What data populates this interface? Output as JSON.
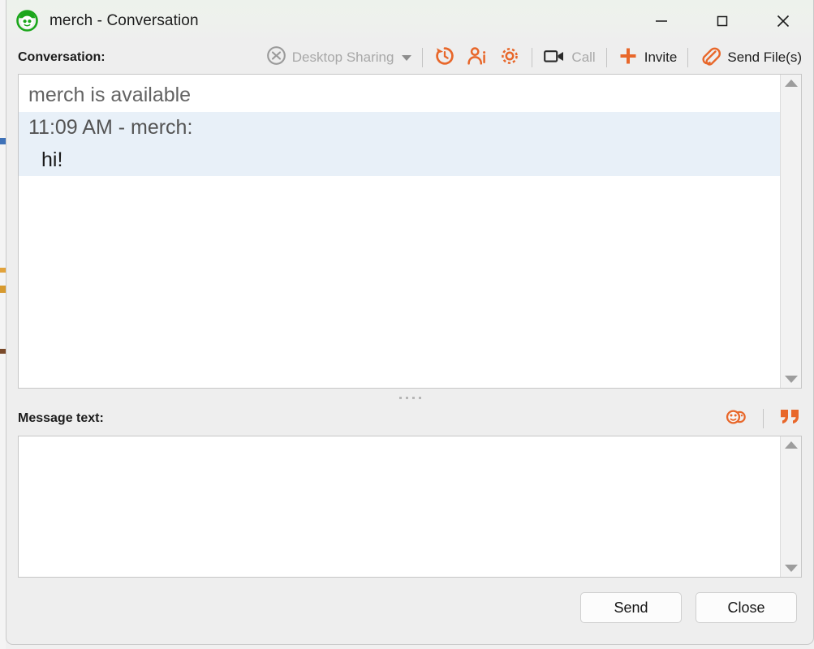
{
  "window": {
    "title": "merch - Conversation",
    "app_icon": "pidgin-buddy-icon",
    "controls": {
      "minimize": "minimize-icon",
      "maximize": "maximize-icon",
      "close": "close-icon"
    }
  },
  "conversation_section": {
    "label": "Conversation:"
  },
  "toolbar": {
    "items": [
      {
        "id": "desktop-sharing",
        "label": "Desktop Sharing",
        "icon": "desktop-sharing-icon",
        "disabled": true,
        "has_caret": true
      },
      {
        "id": "history",
        "label": "",
        "icon": "history-icon",
        "disabled": false
      },
      {
        "id": "user-info",
        "label": "",
        "icon": "user-info-icon",
        "disabled": false
      },
      {
        "id": "settings",
        "label": "",
        "icon": "gear-icon",
        "disabled": false
      },
      {
        "id": "call",
        "label": "Call",
        "icon": "video-call-icon",
        "disabled": true
      },
      {
        "id": "invite",
        "label": "Invite",
        "icon": "plus-icon",
        "disabled": false
      },
      {
        "id": "send-files",
        "label": "Send File(s)",
        "icon": "paperclip-icon",
        "disabled": false
      }
    ]
  },
  "conversation": {
    "lines": [
      {
        "type": "system",
        "text": "merch is available"
      },
      {
        "type": "message_header",
        "text": "11:09 AM - merch:"
      },
      {
        "type": "message_body",
        "text": "hi!"
      }
    ],
    "highlight_color": "#e8f0f8",
    "scrollbar": {
      "up": "scroll-up-arrow-icon",
      "down": "scroll-down-arrow-icon"
    }
  },
  "message_section": {
    "label": "Message text:",
    "value": "",
    "placeholder": "",
    "tools": [
      {
        "id": "emoji",
        "icon": "smiley-faces-icon"
      },
      {
        "id": "quote",
        "icon": "quote-marks-icon"
      }
    ],
    "scrollbar": {
      "up": "scroll-up-arrow-icon",
      "down": "scroll-down-arrow-icon"
    }
  },
  "footer": {
    "send_label": "Send",
    "close_label": "Close"
  },
  "colors": {
    "accent_orange": "#e8672a",
    "icon_green": "#1aa61a",
    "window_bg": "#eeeeee",
    "titlebar_bg": "#edf2ec"
  }
}
